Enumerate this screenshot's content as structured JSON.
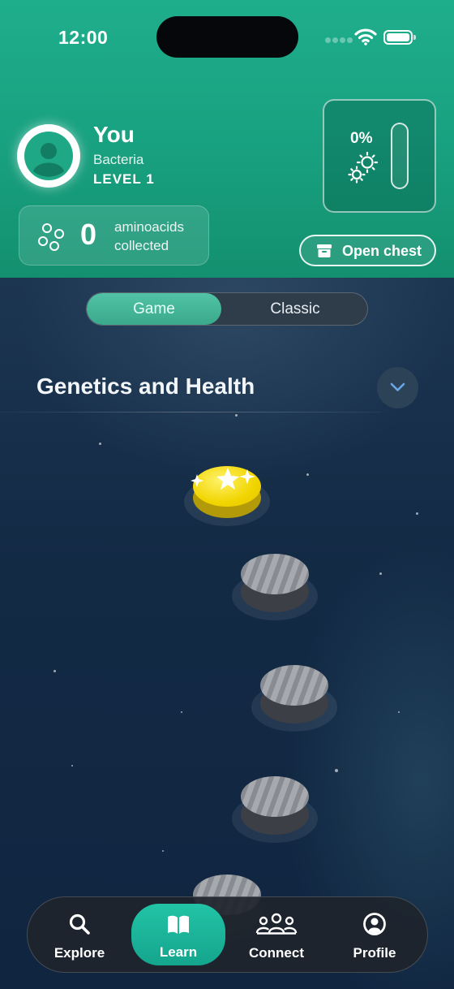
{
  "status_bar": {
    "time": "12:00"
  },
  "profile": {
    "name": "You",
    "species": "Bacteria",
    "level": "LEVEL 1"
  },
  "aminoacids": {
    "count": "0",
    "label": "aminoacids collected"
  },
  "progress": {
    "percent_label": "0%",
    "fraction": 0
  },
  "chest": {
    "label": "Open chest"
  },
  "mode_toggle": {
    "options": [
      "Game",
      "Classic"
    ],
    "selected": "Game"
  },
  "section": {
    "title": "Genetics and Health"
  },
  "path_nodes": [
    {
      "state": "completed"
    },
    {
      "state": "locked"
    },
    {
      "state": "locked"
    },
    {
      "state": "locked"
    },
    {
      "state": "locked"
    }
  ],
  "tab_bar": {
    "items": [
      {
        "label": "Explore",
        "icon": "search-icon"
      },
      {
        "label": "Learn",
        "icon": "book-icon"
      },
      {
        "label": "Connect",
        "icon": "people-icon"
      },
      {
        "label": "Profile",
        "icon": "person-circle-icon"
      }
    ],
    "active": "Learn"
  },
  "colors": {
    "accent": "#1fae8c",
    "background": "#132a45",
    "gold": "#f1d500"
  }
}
